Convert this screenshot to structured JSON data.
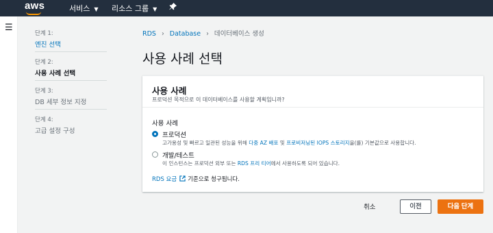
{
  "topnav": {
    "logo": "aws",
    "services": "서비스",
    "resource_groups": "리소스 그룹",
    "pin_icon": "pushpin-icon",
    "bg_color": "#232f3e",
    "accent": "#ff9900"
  },
  "steps": [
    {
      "num": "단계 1:",
      "label": "엔진 선택",
      "state": "link"
    },
    {
      "num": "단계 2:",
      "label": "사용 사례 선택",
      "state": "active"
    },
    {
      "num": "단계 3:",
      "label": "DB 세부 정보 지정",
      "state": "muted"
    },
    {
      "num": "단계 4:",
      "label": "고급 설정 구성",
      "state": "muted"
    }
  ],
  "breadcrumb": {
    "rds": "RDS",
    "database": "Database",
    "current": "데이터베이스 생성"
  },
  "page_title": "사용 사례 선택",
  "card": {
    "title": "사용 사례",
    "description": "프로덕션 목적으로 이 데이터베이스를 사용할 계획입니까?",
    "field_label": "사용 사례",
    "options": [
      {
        "title": "프로덕션",
        "checked": true,
        "desc_pre": "고가용성 및 빠르고 일관된 성능을 위해 ",
        "link1": "다중 AZ 배포",
        "desc_mid": " 및 ",
        "link2": "프로비저닝된 IOPS 스토리지",
        "desc_post": "을(를) 기본값으로 사용합니다."
      },
      {
        "title": "개발/테스트",
        "checked": false,
        "desc_pre": "이 인스턴스는 프로덕션 외부 또는 ",
        "link1": "RDS 프리 티어",
        "desc_post": "에서 사용하도록 되어 있습니다."
      }
    ],
    "pricing_link": "RDS 요금",
    "pricing_text": "기준으로 청구됩니다."
  },
  "footer": {
    "cancel": "취소",
    "previous": "이전",
    "next": "다음 단계",
    "primary_color": "#ec7211"
  }
}
